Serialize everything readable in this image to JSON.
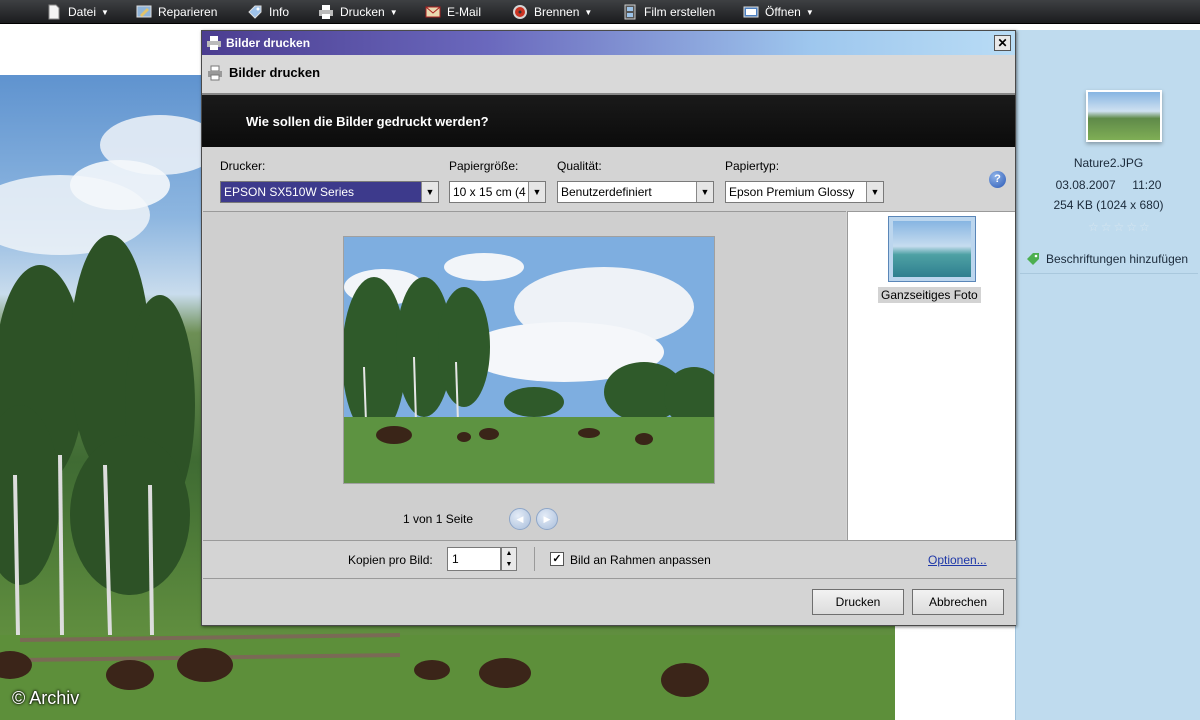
{
  "toolbar": {
    "items": [
      {
        "label": "Datei",
        "icon": "document-icon"
      },
      {
        "label": "Reparieren",
        "icon": "repair-icon"
      },
      {
        "label": "Info",
        "icon": "info-tag-icon"
      },
      {
        "label": "Drucken",
        "icon": "printer-icon"
      },
      {
        "label": "E-Mail",
        "icon": "email-icon"
      },
      {
        "label": "Brennen",
        "icon": "burn-disc-icon"
      },
      {
        "label": "Film erstellen",
        "icon": "film-icon"
      },
      {
        "label": "Öffnen",
        "icon": "open-icon"
      }
    ]
  },
  "dialog": {
    "title": "Bilder drucken",
    "subtitle": "Bilder drucken",
    "question": "Wie sollen die Bilder gedruckt werden?",
    "printer": {
      "label": "Drucker:",
      "value": "EPSON SX510W Series"
    },
    "paper_size": {
      "label": "Papiergröße:",
      "value": "10 x 15 cm (4"
    },
    "quality": {
      "label": "Qualität:",
      "value": "Benutzerdefiniert"
    },
    "paper_type": {
      "label": "Papiertyp:",
      "value": "Epson Premium Glossy"
    },
    "help": "?",
    "page_info": "1 von 1 Seite",
    "layout_label": "Ganzseitiges Foto",
    "copies_label": "Kopien pro Bild:",
    "copies_value": "1",
    "fit_frame_label": "Bild an Rahmen anpassen",
    "fit_frame_checked": true,
    "options_link": "Optionen...",
    "print_button": "Drucken",
    "cancel_button": "Abbrechen"
  },
  "info_panel": {
    "filename": "Nature2.JPG",
    "date": "03.08.2007",
    "time": "11:20",
    "size": "254 KB (1024 x 680)",
    "rating": "☆☆☆☆☆",
    "add_tags": "Beschriftungen hinzufügen"
  },
  "watermark": "© Archiv",
  "colors": {
    "title_bar_start": "#4b3d90",
    "title_bar_end": "#b9dcf5",
    "question_bar": "#111111",
    "link": "#1f38a8",
    "info_panel_bg": "#bfdbee"
  }
}
